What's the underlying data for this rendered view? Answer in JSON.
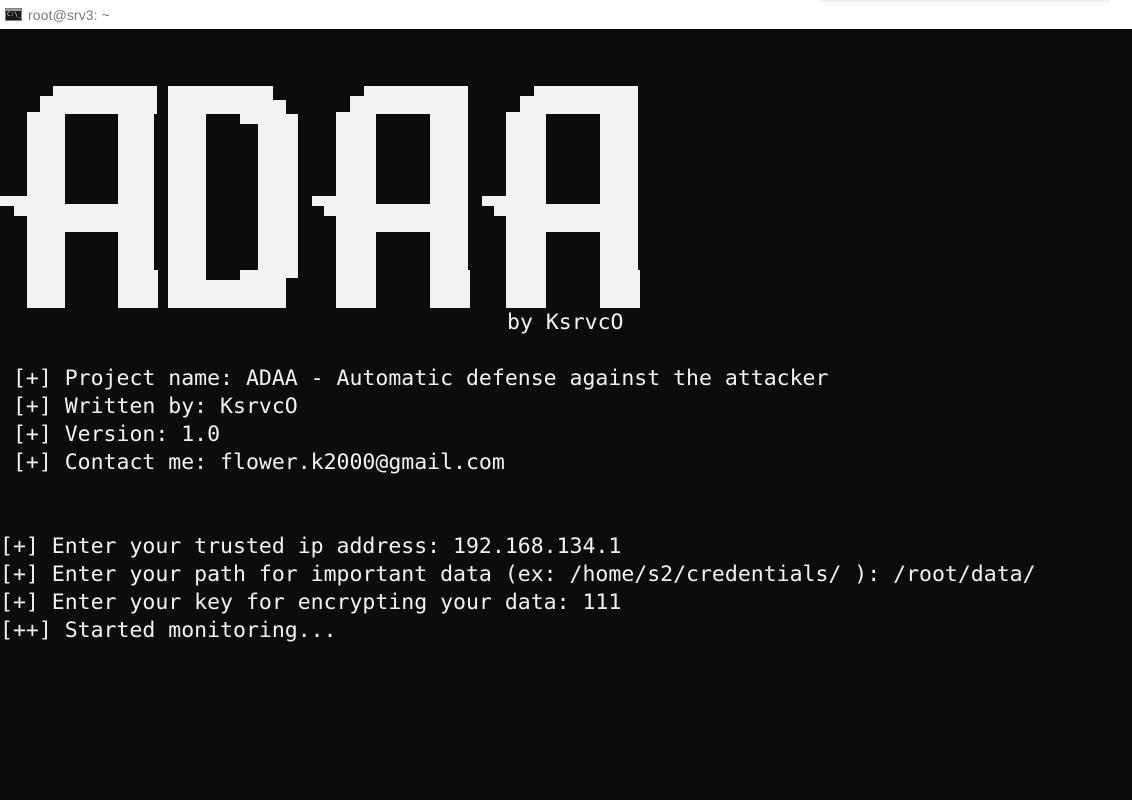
{
  "window": {
    "title": "root@srv3: ~",
    "icon": "console-icon"
  },
  "banner": {
    "art_text": "ADAA",
    "author_line": "by KsrvcO"
  },
  "info": [
    " [+] Project name: ADAA - Automatic defense against the attacker",
    " [+] Written by: KsrvcO",
    " [+] Version: 1.0",
    " [+] Contact me: flower.k2000@gmail.com"
  ],
  "session": [
    "[+] Enter your trusted ip address: 192.168.134.1",
    "[+] Enter your path for important data (ex: /home/s2/credentials/ ): /root/data/",
    "[+] Enter your key for encrypting your data: 111",
    "[++] Started monitoring..."
  ],
  "colors": {
    "background": "#0c0c0c",
    "foreground": "#f2f2f2",
    "titlebar": "#ffffff",
    "title_text": "#7a7a7a"
  }
}
